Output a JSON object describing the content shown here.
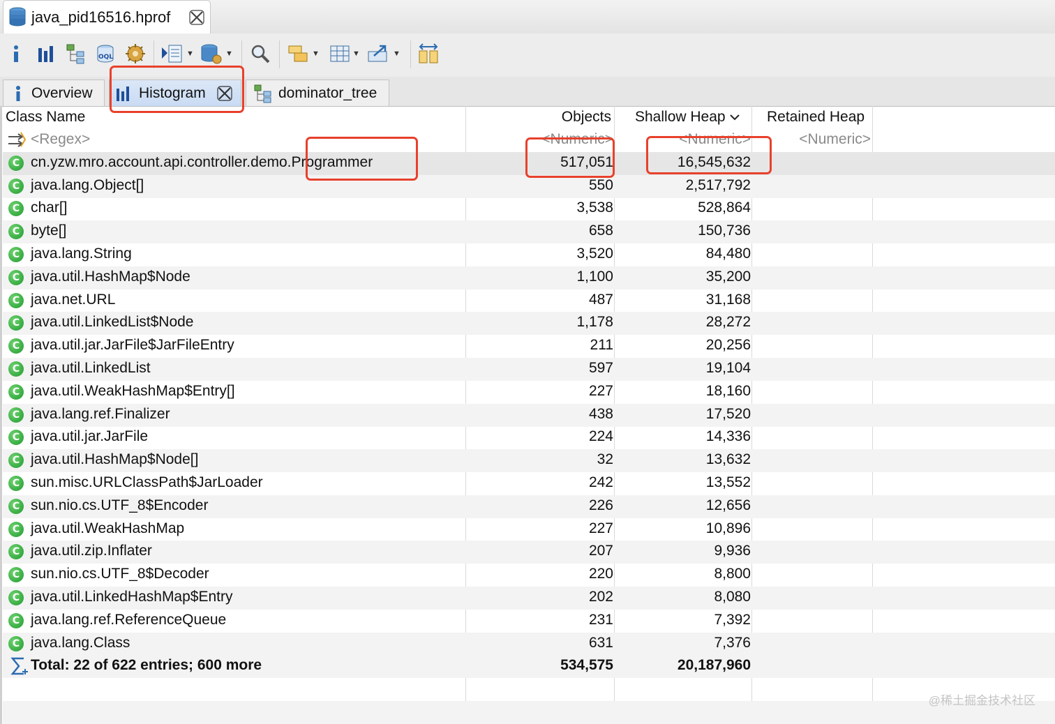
{
  "editor_tab": {
    "title": "java_pid16516.hprof"
  },
  "toolbar": {
    "icons": [
      "info-icon",
      "histogram-icon",
      "dominator-tree-icon",
      "oql-icon",
      "heap-dump-overview-icon",
      "query-browser-icon",
      "find-object-icon",
      "search-icon",
      "group-by-icon",
      "calculate-heap-icon",
      "export-icon",
      "compare-icon"
    ]
  },
  "view_tabs": [
    {
      "label": "Overview",
      "icon": "info-icon",
      "active": false
    },
    {
      "label": "Histogram",
      "icon": "histogram-icon",
      "active": true
    },
    {
      "label": "dominator_tree",
      "icon": "dominator-tree-icon",
      "active": false
    }
  ],
  "table": {
    "columns": {
      "class_name": "Class Name",
      "objects": "Objects",
      "shallow_heap": "Shallow Heap",
      "shallow_heap_sort": "sorted-descending",
      "retained_heap": "Retained Heap"
    },
    "filter_row": {
      "class_name": "<Regex>",
      "objects": "<Numeric>",
      "shallow_heap": "<Numeric>",
      "retained_heap": "<Numeric>"
    },
    "rows": [
      {
        "name": "cn.yzw.mro.account.api.controller.demo.Programmer",
        "objects": "517,051",
        "shallow": "16,545,632"
      },
      {
        "name": "java.lang.Object[]",
        "objects": "550",
        "shallow": "2,517,792"
      },
      {
        "name": "char[]",
        "objects": "3,538",
        "shallow": "528,864"
      },
      {
        "name": "byte[]",
        "objects": "658",
        "shallow": "150,736"
      },
      {
        "name": "java.lang.String",
        "objects": "3,520",
        "shallow": "84,480"
      },
      {
        "name": "java.util.HashMap$Node",
        "objects": "1,100",
        "shallow": "35,200"
      },
      {
        "name": "java.net.URL",
        "objects": "487",
        "shallow": "31,168"
      },
      {
        "name": "java.util.LinkedList$Node",
        "objects": "1,178",
        "shallow": "28,272"
      },
      {
        "name": "java.util.jar.JarFile$JarFileEntry",
        "objects": "211",
        "shallow": "20,256"
      },
      {
        "name": "java.util.LinkedList",
        "objects": "597",
        "shallow": "19,104"
      },
      {
        "name": "java.util.WeakHashMap$Entry[]",
        "objects": "227",
        "shallow": "18,160"
      },
      {
        "name": "java.lang.ref.Finalizer",
        "objects": "438",
        "shallow": "17,520"
      },
      {
        "name": "java.util.jar.JarFile",
        "objects": "224",
        "shallow": "14,336"
      },
      {
        "name": "java.util.HashMap$Node[]",
        "objects": "32",
        "shallow": "13,632"
      },
      {
        "name": "sun.misc.URLClassPath$JarLoader",
        "objects": "242",
        "shallow": "13,552"
      },
      {
        "name": "sun.nio.cs.UTF_8$Encoder",
        "objects": "226",
        "shallow": "12,656"
      },
      {
        "name": "java.util.WeakHashMap",
        "objects": "227",
        "shallow": "10,896"
      },
      {
        "name": "java.util.zip.Inflater",
        "objects": "207",
        "shallow": "9,936"
      },
      {
        "name": "sun.nio.cs.UTF_8$Decoder",
        "objects": "220",
        "shallow": "8,800"
      },
      {
        "name": "java.util.LinkedHashMap$Entry",
        "objects": "202",
        "shallow": "8,080"
      },
      {
        "name": "java.lang.ref.ReferenceQueue",
        "objects": "231",
        "shallow": "7,392"
      },
      {
        "name": "java.lang.Class",
        "objects": "631",
        "shallow": "7,376"
      }
    ],
    "total": {
      "label": "Total: 22 of 622 entries; 600 more",
      "objects": "534,575",
      "shallow": "20,187,960"
    }
  },
  "watermark": "@稀土掘金技术社区",
  "colors": {
    "highlight": "#e8412c",
    "class_icon": "#2ea43a",
    "selected_row": "#e6e6e6"
  }
}
